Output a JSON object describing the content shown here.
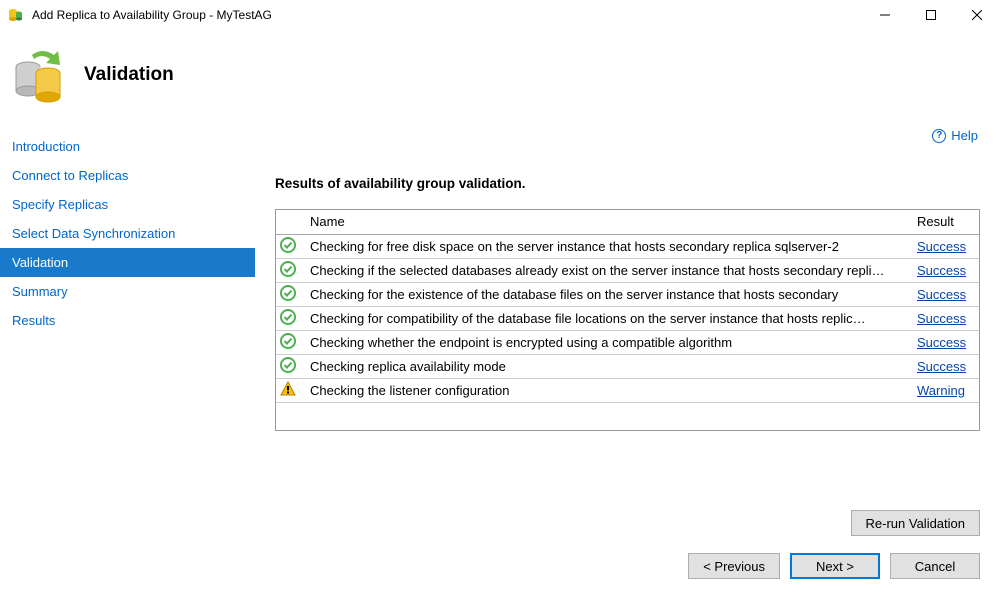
{
  "window": {
    "title": "Add Replica to Availability Group - MyTestAG"
  },
  "header": {
    "title": "Validation"
  },
  "sidebar": {
    "items": [
      {
        "label": "Introduction"
      },
      {
        "label": "Connect to Replicas"
      },
      {
        "label": "Specify Replicas"
      },
      {
        "label": "Select Data Synchronization"
      },
      {
        "label": "Validation"
      },
      {
        "label": "Summary"
      },
      {
        "label": "Results"
      }
    ]
  },
  "help": {
    "label": "Help"
  },
  "results": {
    "heading": "Results of availability group validation.",
    "columns": {
      "name": "Name",
      "result": "Result"
    },
    "rows": [
      {
        "status": "success",
        "name": "Checking for free disk space on the server instance that hosts secondary replica sqlserver-2",
        "result": "Success"
      },
      {
        "status": "success",
        "name": "Checking if the selected databases already exist on the server instance that hosts secondary repli…",
        "result": "Success"
      },
      {
        "status": "success",
        "name": "Checking for the existence of the database files on the server instance that hosts secondary",
        "result": "Success"
      },
      {
        "status": "success",
        "name": "Checking for compatibility of the database file locations on the server instance that hosts replic…",
        "result": "Success"
      },
      {
        "status": "success",
        "name": "Checking whether the endpoint is encrypted using a compatible algorithm",
        "result": "Success"
      },
      {
        "status": "success",
        "name": "Checking replica availability mode",
        "result": "Success"
      },
      {
        "status": "warning",
        "name": "Checking the listener configuration",
        "result": "Warning"
      }
    ]
  },
  "buttons": {
    "rerun": "Re-run Validation",
    "previous": "< Previous",
    "next": "Next >",
    "cancel": "Cancel"
  }
}
